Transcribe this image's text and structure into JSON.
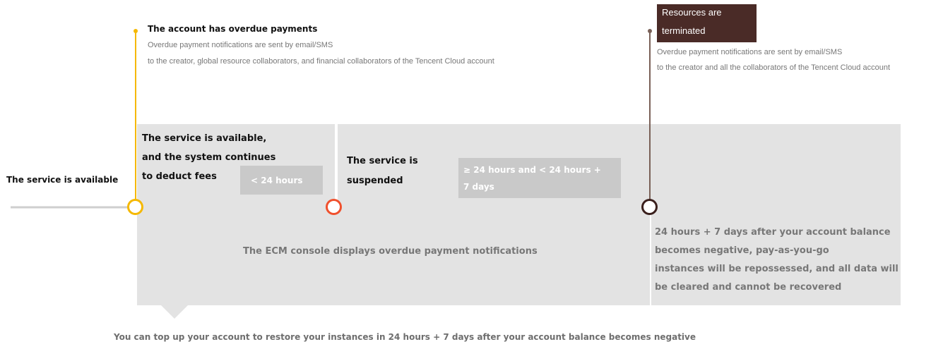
{
  "colors": {
    "yellow": "#f5b800",
    "orange_red": "#f0502d",
    "dark_brown": "#3a1f1c",
    "navy": "#1f2a5c",
    "panel_gray": "#e3e3e3",
    "tag_gray": "#c9c9c9",
    "callout_bg": "#4a2b27"
  },
  "stage_available": {
    "label": "The service is available"
  },
  "overdue_event": {
    "title": "The account has overdue payments",
    "note_line1": "Overdue payment notifications are sent by email/SMS",
    "note_line2": "to the creator, global resource collaborators, and financial collaborators of the Tencent Cloud account"
  },
  "terminated_event": {
    "title_line1": "Resources are",
    "title_line2": "terminated",
    "note_line1": "Overdue payment notifications are sent by email/SMS",
    "note_line2": "to the creator and all the collaborators of the Tencent Cloud account"
  },
  "stage_deduct": {
    "line1": "The service is available,",
    "line2": "and the system continues",
    "line3": "to deduct fees",
    "duration": "< 24 hours"
  },
  "stage_suspended": {
    "line1": "The service is",
    "line2": "suspended",
    "duration_line1": "≥ 24 hours and < 24 hours +",
    "duration_line2": "7 days"
  },
  "console_notice": "The ECM console displays overdue payment notifications",
  "reclaim_notice": {
    "line1": "24 hours + 7 days after your account balance",
    "line2": "becomes negative, pay-as-you-go",
    "line3": "instances will be repossessed, and all data will",
    "line4": "be cleared and cannot be recovered"
  },
  "topup_notice": "You can top up your account to restore your instances in 24 hours + 7 days after your account balance becomes negative"
}
